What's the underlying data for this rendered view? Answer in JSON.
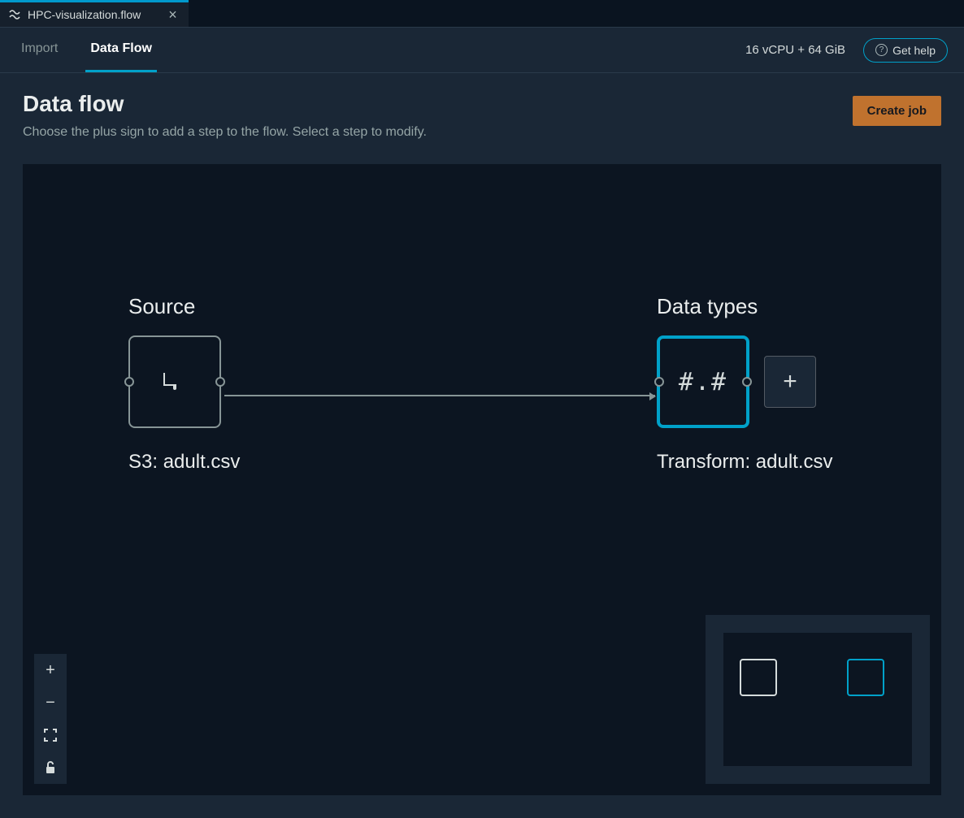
{
  "file_tab": {
    "name": "HPC-visualization.flow"
  },
  "tabs": {
    "import": "Import",
    "data_flow": "Data Flow",
    "active": "data_flow"
  },
  "toolbar": {
    "resource_label": "16 vCPU + 64 GiB",
    "help_label": "Get help"
  },
  "header": {
    "title": "Data flow",
    "subtitle": "Choose the plus sign to add a step to the flow. Select a step to modify.",
    "create_job_label": "Create job"
  },
  "flow": {
    "source": {
      "heading": "Source",
      "caption": "S3: adult.csv",
      "icon": "document-icon"
    },
    "data_types": {
      "heading": "Data types",
      "caption": "Transform: adult.csv",
      "symbol": "#.#",
      "selected": true
    },
    "add_label": "+"
  },
  "zoom": {
    "in_label": "+",
    "out_label": "−",
    "fit_icon": "fullscreen-icon",
    "lock_icon": "lock-icon"
  }
}
